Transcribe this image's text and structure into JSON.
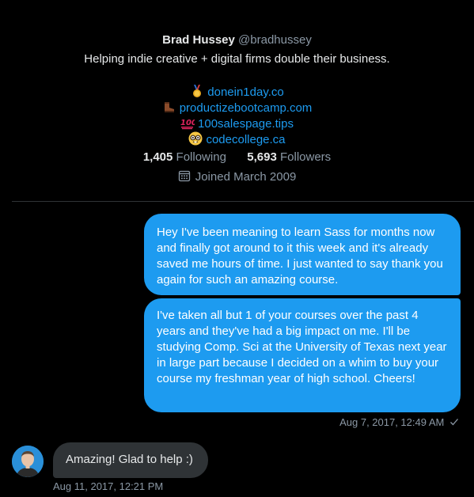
{
  "profile": {
    "name": "Brad Hussey",
    "handle": "@bradhussey",
    "bio": "Helping indie creative + digital firms double their business.",
    "links": [
      {
        "icon": "medal-emoji",
        "text": "donein1day.co"
      },
      {
        "icon": "boot-emoji",
        "text": "productizebootcamp.com"
      },
      {
        "icon": "hundred-points-emoji",
        "text": "100salespage.tips"
      },
      {
        "icon": "nerd-face-emoji",
        "text": "codecollege.ca"
      }
    ],
    "following_count": "1,405",
    "following_label": "Following",
    "followers_count": "5,693",
    "followers_label": "Followers",
    "joined": "Joined March 2009"
  },
  "messages": {
    "outgoing": [
      {
        "text": "Hey I've been meaning to learn Sass for months now and finally got around to it this week and it's already saved me hours of time. I just wanted to say thank you again for such an amazing course."
      },
      {
        "text": "I've taken all but 1 of your courses over the past 4 years and they've had a big impact on me. I'll be studying Comp. Sci at the University of Texas next year in large part because I decided on a whim to buy your course my freshman year of high school. Cheers!"
      }
    ],
    "outgoing_timestamp": "Aug 7, 2017, 12:49 AM",
    "incoming": [
      {
        "text": "Amazing! Glad to help :)"
      }
    ],
    "incoming_timestamp": "Aug 11, 2017, 12:21 PM"
  },
  "colors": {
    "background": "#000000",
    "accent": "#1d9bf0",
    "incoming_bubble": "#2f3336",
    "muted_text": "#8b98a5"
  }
}
